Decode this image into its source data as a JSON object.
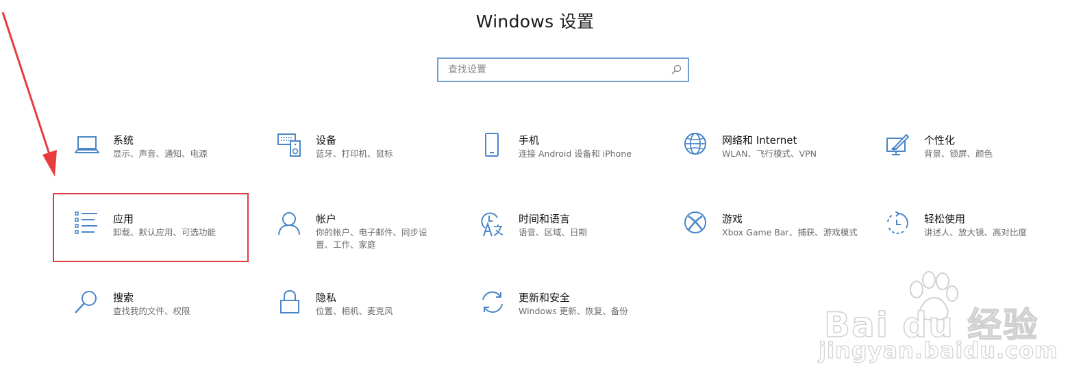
{
  "window": {
    "title": "Windows 设置"
  },
  "search": {
    "placeholder": "查找设置",
    "value": ""
  },
  "colors": {
    "accent": "#4a86c8",
    "search_border": "#6f9fcf",
    "highlight": "#e0393e",
    "description": "#6b6b6b"
  },
  "categories": [
    {
      "label": "系统",
      "description": "显示、声音、通知、电源",
      "icon": "laptop-icon"
    },
    {
      "label": "设备",
      "description": "蓝牙、打印机、鼠标",
      "icon": "devices-icon"
    },
    {
      "label": "手机",
      "description": "连接 Android 设备和 iPhone",
      "icon": "phone-icon"
    },
    {
      "label": "网络和 Internet",
      "description": "WLAN、飞行模式、VPN",
      "icon": "globe-icon"
    },
    {
      "label": "个性化",
      "description": "背景、锁屏、颜色",
      "icon": "personalization-icon"
    },
    {
      "label": "应用",
      "description": "卸载、默认应用、可选功能",
      "icon": "apps-list-icon"
    },
    {
      "label": "帐户",
      "description": "你的帐户、电子邮件、同步设置、工作、家庭",
      "icon": "person-icon"
    },
    {
      "label": "时间和语言",
      "description": "语音、区域、日期",
      "icon": "time-language-icon"
    },
    {
      "label": "游戏",
      "description": "Xbox Game Bar、捕获、游戏模式",
      "icon": "xbox-icon"
    },
    {
      "label": "轻松使用",
      "description": "讲述人、放大镜、高对比度",
      "icon": "ease-of-access-icon"
    },
    {
      "label": "搜索",
      "description": "查找我的文件、权限",
      "icon": "search-magnifier-icon"
    },
    {
      "label": "隐私",
      "description": "位置、相机、麦克风",
      "icon": "lock-icon"
    },
    {
      "label": "更新和安全",
      "description": "Windows 更新、恢复、备份",
      "icon": "sync-icon"
    }
  ],
  "watermark": {
    "brand": "Bai du 经验",
    "url": "jingyan.baidu.com"
  }
}
